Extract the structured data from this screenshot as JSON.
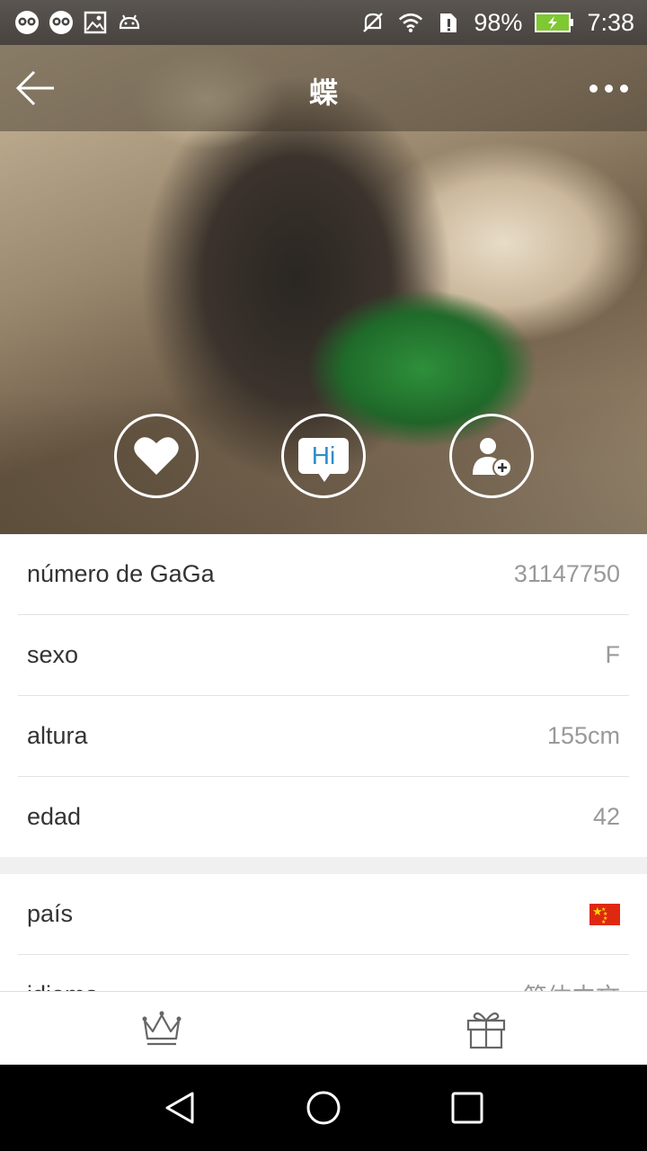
{
  "status_bar": {
    "battery": "98%",
    "time": "7:38",
    "left_icons": [
      "owl-icon",
      "owl-icon",
      "image-icon",
      "android-icon"
    ],
    "right_icons": [
      "mute-icon",
      "wifi-icon",
      "sim-alert-icon",
      "battery-charging-icon"
    ]
  },
  "header": {
    "title": "蝶",
    "back_icon": "arrow-left-icon",
    "more_icon": "more-dots-icon"
  },
  "actions": {
    "like_icon": "heart-icon",
    "hi_label": "Hi",
    "follow_icon": "add-user-icon"
  },
  "profile": {
    "rows": [
      {
        "label": "número de GaGa",
        "value": "31147750"
      },
      {
        "label": "sexo",
        "value": "F"
      },
      {
        "label": "altura",
        "value": "155cm"
      },
      {
        "label": "edad",
        "value": "42"
      }
    ],
    "country_label": "país",
    "country_flag": "china-flag-icon",
    "language_label": "idioma",
    "language_value": "简体中文"
  },
  "tabbar": {
    "left_icon": "crown-icon",
    "right_icon": "gift-icon"
  },
  "navbar": {
    "icons": [
      "back-triangle-icon",
      "home-circle-icon",
      "recents-square-icon"
    ]
  },
  "colors": {
    "accent_blue": "#2e8dcc",
    "value_gray": "#999999",
    "flag_red": "#de2910"
  }
}
